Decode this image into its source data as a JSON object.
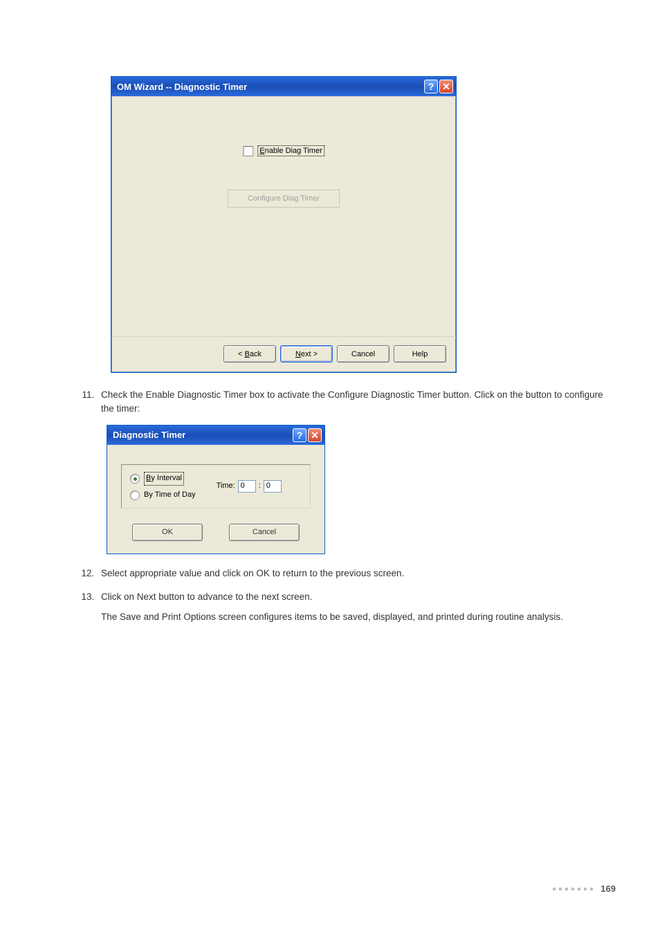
{
  "dlg1": {
    "title": "OM Wizard -- Diagnostic Timer",
    "help_glyph": "?",
    "close_glyph": "✕",
    "enable_label": "Enable Diag Timer",
    "configure_label": "Configure Diag Timer",
    "buttons": {
      "back_prefix": "< ",
      "back_u": "B",
      "back_rest": "ack",
      "next_u": "N",
      "next_rest": "ext >",
      "cancel": "Cancel",
      "help": "Help"
    }
  },
  "steps": {
    "s11_a": "Check the Enable Diagnostic Timer box to activate the Configure Diagnostic Timer button. Click on the button to configure the timer:",
    "s12": "Select appropriate value and click on OK to return to the previous screen.",
    "s13": "Click on Next button to advance to the next screen.",
    "s13_b": "The Save and Print Options screen configures items to be saved, displayed, and printed during routine analysis."
  },
  "dlg2": {
    "title": "Diagnostic Timer",
    "help_glyph": "?",
    "close_glyph": "✕",
    "radio1": "By Interval",
    "radio2": "By Time of Day",
    "time_label": "Time:",
    "time_sep": ":",
    "time_h": "0",
    "time_m": "0",
    "ok": "OK",
    "cancel": "Cancel"
  },
  "footer": {
    "page": "169"
  }
}
